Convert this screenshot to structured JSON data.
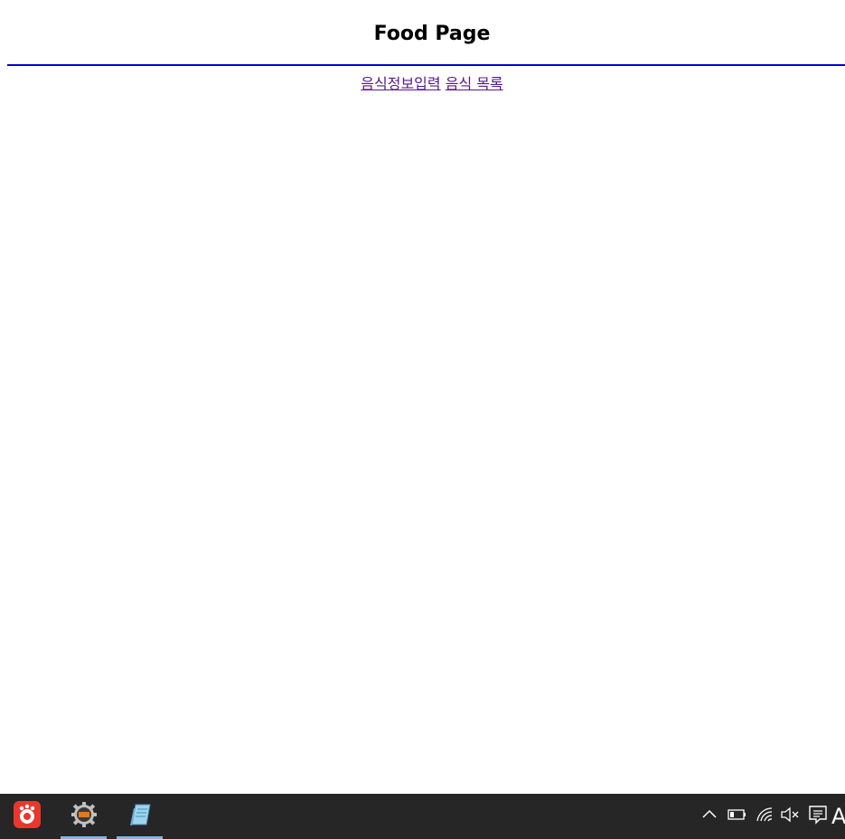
{
  "page": {
    "title": "Food Page",
    "nav_links": [
      {
        "label": "음식정보입력"
      },
      {
        "label": "음식 목록"
      }
    ],
    "link_color": "#551a8b",
    "rule_color": "#0000cc"
  },
  "taskbar": {
    "apps": [
      {
        "icon": "red-app-icon",
        "active": false
      },
      {
        "icon": "gear-tool-icon",
        "active": true
      },
      {
        "icon": "notepad-icon",
        "active": true
      }
    ],
    "tray": {
      "icons": [
        "chevron-up-icon",
        "battery-icon",
        "wifi-icon",
        "volume-muted-icon",
        "notification-icon"
      ],
      "input_indicator": "A"
    },
    "background": "#262626",
    "active_underline": "#76b9ed"
  }
}
